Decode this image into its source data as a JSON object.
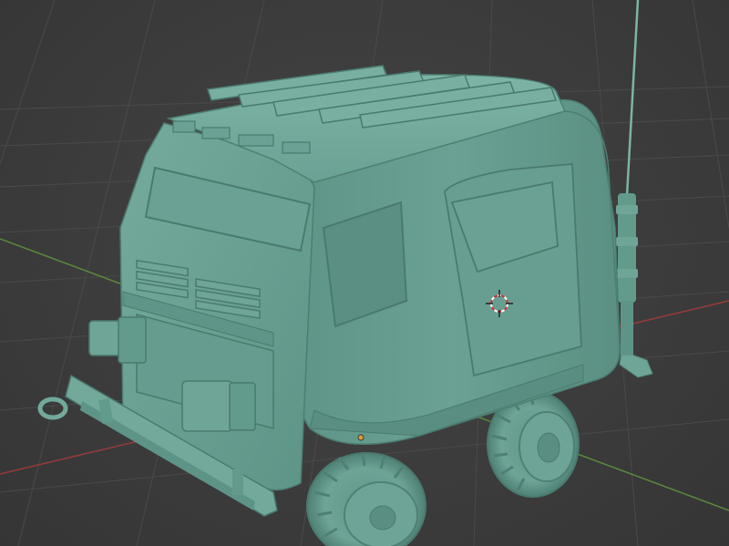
{
  "viewport": {
    "mode": "solid-shading",
    "background_color": "#3d3d3d",
    "grid_color": "#4a4a4a",
    "x_axis_color": "#9a3a3a",
    "y_axis_color": "#5a8a3a",
    "model_color": "#6fa597",
    "origin_color": "#e0a030"
  },
  "model": {
    "name": "offroad-van",
    "icon": "vehicle-mesh"
  },
  "cursor": {
    "icon": "3d-cursor-icon",
    "ring_colors": [
      "#cc3333",
      "#ffffff"
    ]
  }
}
